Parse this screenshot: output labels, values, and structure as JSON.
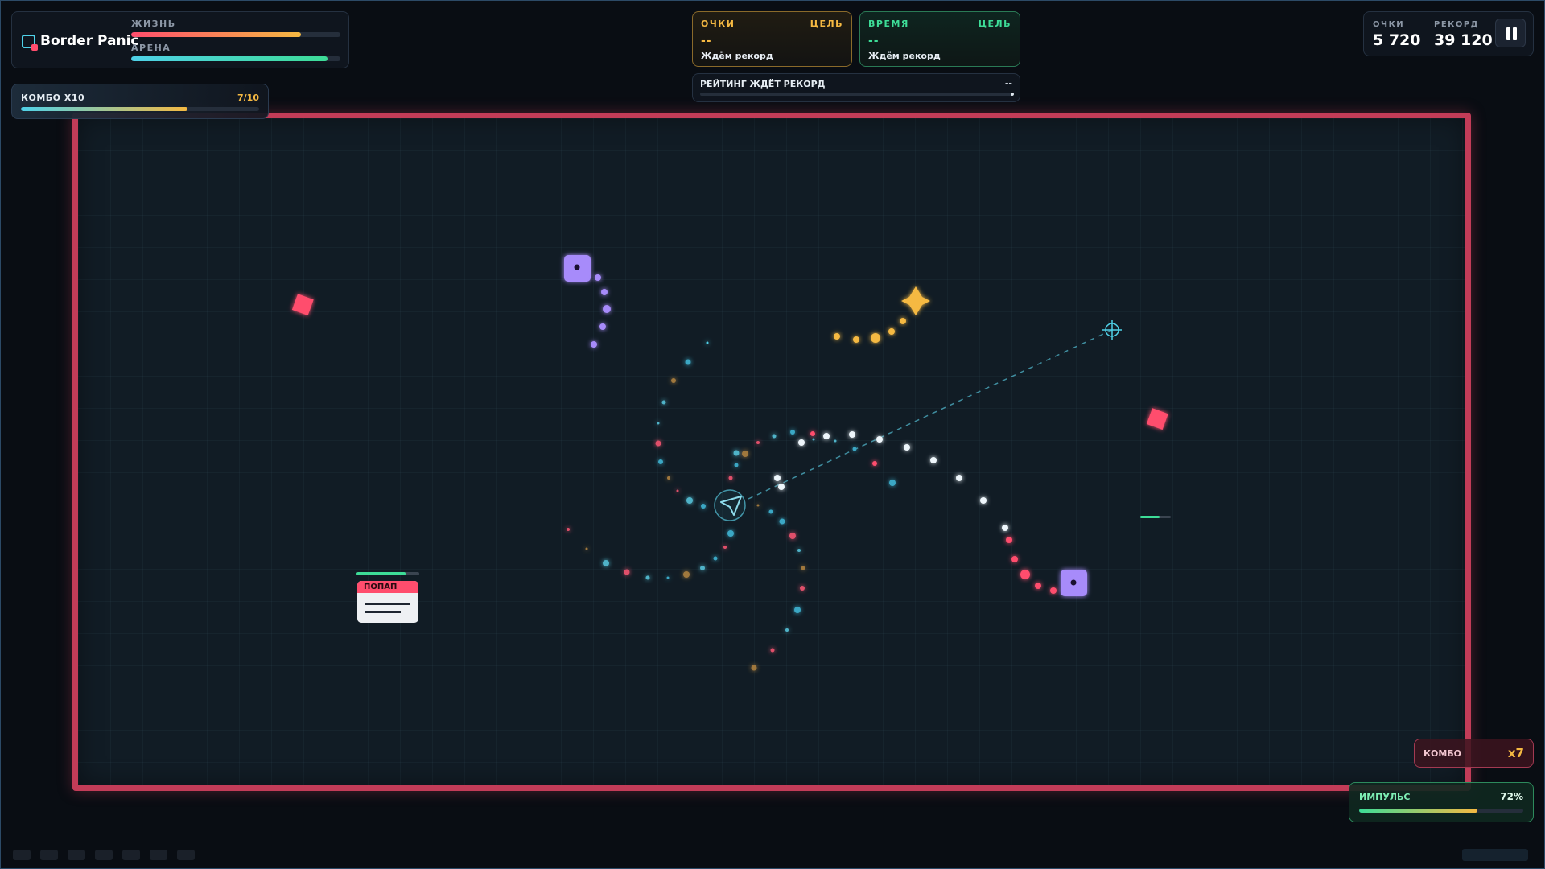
{
  "game": {
    "title": "Border Panic",
    "life_label": "ЖИЗНЬ",
    "life_level": 0.81,
    "arena_label": "АРЕНА",
    "arena_level": 0.94
  },
  "combo_bar": {
    "label": "КОМБО X10",
    "value": "7/10",
    "progress": 0.7
  },
  "objectives": {
    "score": {
      "title": "ОЧКИ",
      "goal_label": "ЦЕЛЬ",
      "value": "--",
      "status": "Ждём рекорд",
      "color": "#f2b84b"
    },
    "time": {
      "title": "ВРЕМЯ",
      "goal_label": "ЦЕЛЬ",
      "value": "--",
      "status": "Ждём рекорд",
      "color": "#3ddc97"
    },
    "rating": {
      "label": "РЕЙТИНГ ЖДЁТ РЕКОРД",
      "value": "--"
    }
  },
  "scoreboard": {
    "score_label": "ОЧКИ",
    "score_value": "5 720",
    "record_label": "РЕКОРД",
    "record_value": "39 120",
    "pause_icon": "pause-icon"
  },
  "arena": {
    "popup_label": "ПОПАП",
    "popup_health": 0.78
  },
  "hud_bottom": {
    "combo_label": "КОМБО",
    "combo_value": "x7",
    "impulse_label": "ИМПУЛЬС",
    "impulse_value": "72%",
    "impulse_level": 0.72
  },
  "colors": {
    "accent_cyan": "#4fd1e8",
    "danger_pink": "#ff4d6d",
    "enemy_purple": "#a78bfa",
    "gold": "#f5b942",
    "green": "#3ddc97",
    "arena_border": "#c23c58"
  }
}
